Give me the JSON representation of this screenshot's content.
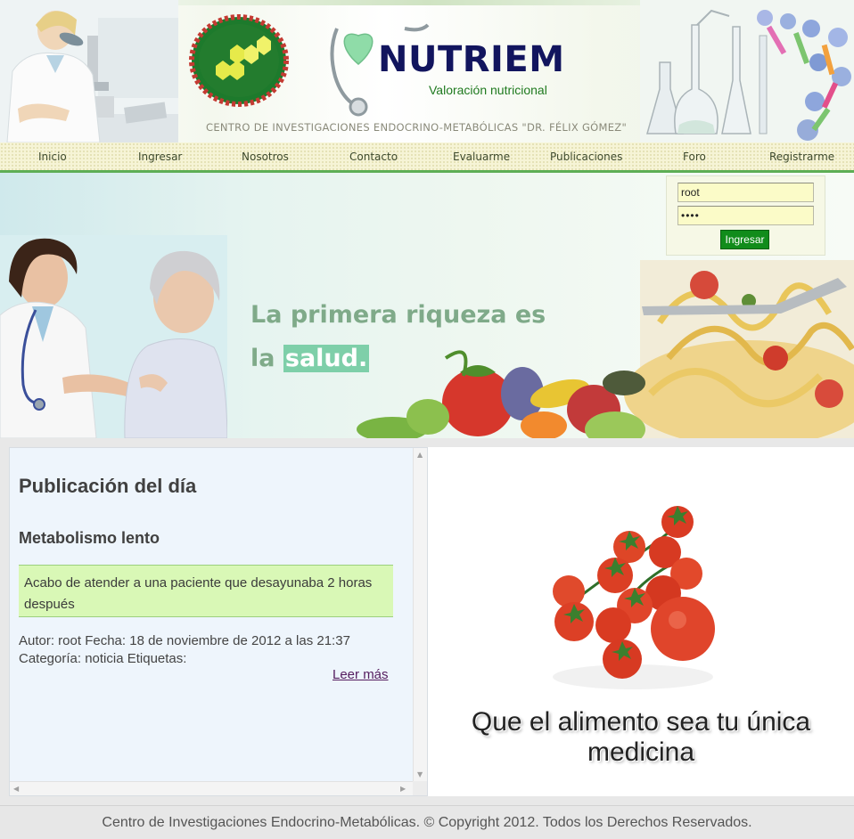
{
  "header": {
    "brand_name": "NUTRIEM",
    "brand_tagline": "Valoración nutricional",
    "center_name": "CENTRO DE INVESTIGACIONES ENDOCRINO-METABÓLICAS \"DR. FÉLIX GÓMEZ\""
  },
  "nav": {
    "items": [
      "Inicio",
      "Ingresar",
      "Nosotros",
      "Contacto",
      "Evaluarme",
      "Publicaciones",
      "Foro",
      "Registrarme"
    ]
  },
  "banner": {
    "slogan_line1": "La primera riqueza es",
    "slogan_line2_prefix": "la ",
    "slogan_line2_highlight": "salud."
  },
  "login": {
    "username_value": "root",
    "password_value": "••••",
    "submit_label": "Ingresar"
  },
  "publication": {
    "heading": "Publicación del día",
    "title": "Metabolismo lento",
    "excerpt": "Acabo de atender a una paciente que desayunaba 2 horas después",
    "meta_line1": "Autor: root Fecha: 18 de noviembre de 2012 a las 21:37",
    "meta_line2": "Categoría: noticia Etiquetas:",
    "read_more": "Leer más"
  },
  "quote": {
    "text": "Que el alimento sea tu única medicina"
  },
  "footer": {
    "text": "Centro de Investigaciones Endocrino-Metabólicas. © Copyright 2012. Todos los Derechos Reservados."
  },
  "colors": {
    "nav_border": "#5dae55",
    "brand_text": "#12155e",
    "tagline": "#1f7a1f",
    "slogan": "#7faa89",
    "slogan_highlight": "#7ecfa9",
    "login_button": "#118c1b",
    "excerpt_bg": "#d9f8b6"
  }
}
